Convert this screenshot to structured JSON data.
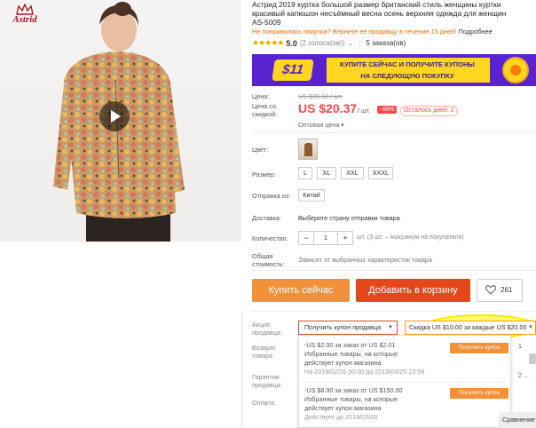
{
  "brand": {
    "logo_text": "Astrid"
  },
  "title_lines": [
    "Астрид 2019 куртка большой размер британский стиль женщины куртки",
    "красивый капюшон несъёмный весна осень верхняя одежда для женщин",
    "AS-5009"
  ],
  "promo_line": {
    "highlight": "Не понравилась покупка? Вернете её продавцу в течение 15 дней!",
    "link": "Подробнее"
  },
  "rating": {
    "stars": "★★★★★",
    "value": "5.0",
    "votes": "(2 голоса(ов))",
    "orders": "5 заказа(ов)"
  },
  "banner": {
    "amount": "$11",
    "text_line1": "КУПИТЕ СЕЙЧАС И ПОЛУЧИТЕ КУПОНЫ",
    "text_line2": "НА СЛЕДУЮЩУЮ ПОКУПКУ"
  },
  "price": {
    "label": "Цена:",
    "old": "US $39.18 / шт.",
    "discount_label_line1": "Цена со",
    "discount_label_line2": "скидкой:",
    "current": "US $20.37",
    "unit": "/ шт.",
    "discount": "-48%",
    "days_left": "Осталось дней: 2",
    "wholesale": "Оптовая цена ▾"
  },
  "options": {
    "color_label": "Цвет:",
    "size_label": "Размер:",
    "sizes": [
      "L",
      "XL",
      "XXL",
      "XXXL"
    ],
    "ship_from_label": "Отправка из:",
    "ship_from_value": "Китай",
    "delivery_label": "Доставка:",
    "delivery_value": "Выберите страну отправки товара",
    "qty_label": "Количество:",
    "qty_minus": "−",
    "qty_value": "1",
    "qty_plus": "+",
    "qty_note": "шт. (3 шт. – максимум на покупателя)",
    "total_label_line1": "Общая",
    "total_label_line2": "стоимость:",
    "total_value": "Зависит от выбранных характеристик товара"
  },
  "actions": {
    "buy": "Купить сейчас",
    "cart": "Добавить в корзину",
    "likes": "261"
  },
  "store": {
    "promo_label_line1": "Акция",
    "promo_label_line2": "продавца:",
    "coupon_select": "Получить купон продавца",
    "discount_select": "Скидка US $10.00 за каждые US $20.00",
    "return_label_line1": "Возврат",
    "return_label_line2": "товара",
    "guarantee_label_line1": "Гарантии",
    "guarantee_label_line2": "продавца:",
    "payment_label": "Оплата:",
    "coupons": [
      {
        "line1": "-US $2.00 за заказ от US $2.01",
        "line2": "Избранные товары, на которые",
        "line3": "действует купон магазина",
        "date": "На 2019/02/26 00:00 до 2019/03/25 23:59",
        "button": "Получить купон"
      },
      {
        "line1": "-US $8.00 за заказ от US $150.00",
        "line2": "Избранные товары, на которые",
        "line3": "действует купон магазина",
        "date": "Действует до 2019/03/03",
        "button": "Получить купон"
      }
    ],
    "corner_text": "Сравнение"
  },
  "ghost_text": [
    "1",
    "2 ..."
  ],
  "colors": {
    "accent": "#ff4747",
    "buy": "#f2913a",
    "cart": "#e4471a",
    "banner_bg": "#5922d0",
    "banner_yellow": "#ffd61f"
  }
}
